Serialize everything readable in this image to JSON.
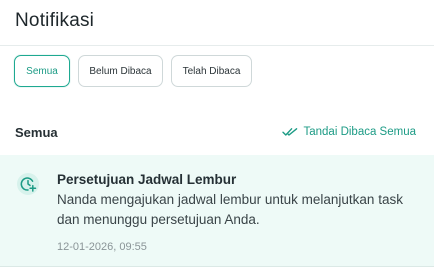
{
  "header": {
    "title": "Notifikasi"
  },
  "filters": {
    "all_label": "Semua",
    "unread_label": "Belum Dibaca",
    "read_label": "Telah Dibaca",
    "active": "Semua"
  },
  "section": {
    "title": "Semua",
    "mark_all_label": "Tandai Dibaca Semua",
    "mark_all_icon": "double-check-icon"
  },
  "notifications": [
    {
      "icon": "clock-plus-icon",
      "title": "Persetujuan Jadwal Lembur",
      "message": "Nanda mengajukan jadwal lembur untuk melanjutkan task dan menunggu persetujuan Anda.",
      "timestamp": "12-01-2026, 09:55",
      "unread": true
    }
  ],
  "colors": {
    "accent": "#1ea991",
    "unread_background": "#eefaf7"
  }
}
